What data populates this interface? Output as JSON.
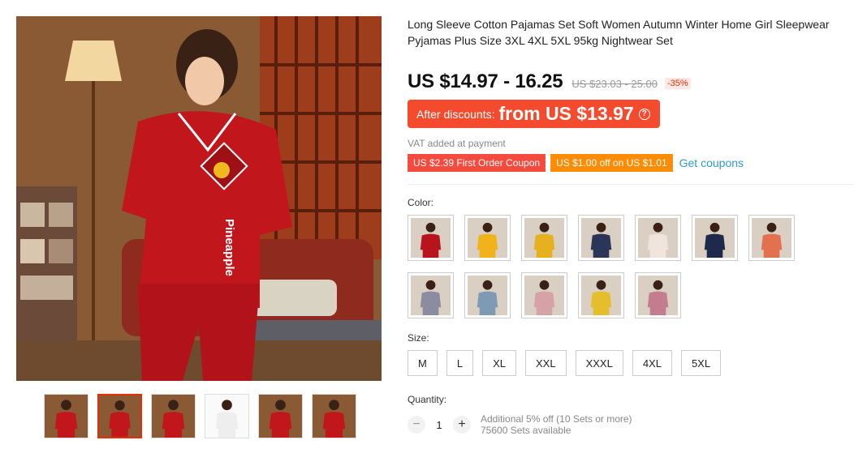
{
  "product": {
    "title": "Long Sleeve Cotton Pajamas Set Soft Women Autumn Winter Home Girl Sleepwear Pyjamas Plus Size 3XL 4XL 5XL 95kg Nightwear Set",
    "main_image_text": "Pineapple",
    "price": "US $14.97 - 16.25",
    "original_price": "US $23.03 - 25.00",
    "discount_badge": "-35%",
    "after_discount_label": "After discounts:",
    "after_discount_amount": "from US $13.97",
    "help_icon_text": "?",
    "vat_note": "VAT added at payment",
    "coupons": [
      "US $2.39 First Order Coupon",
      "US $1.00 off on US $1.01"
    ],
    "get_coupons": "Get coupons",
    "color_label": "Color:",
    "size_label": "Size:",
    "sizes": [
      "M",
      "L",
      "XL",
      "XXL",
      "XXXL",
      "4XL",
      "5XL"
    ],
    "quantity_label": "Quantity:",
    "quantity_value": "1",
    "qty_minus": "−",
    "qty_plus": "+",
    "bulk_note": "Additional 5% off (10 Sets or more)",
    "stock_note": "75600 Sets available"
  },
  "colors": {
    "accent": "#e62e04",
    "after_discount_bg": "#f44b2e",
    "coupon_red": "#f44b3e",
    "coupon_orange": "#fc8c04",
    "link": "#2e9cc3",
    "garment_red": "#c2161d"
  },
  "swatch_colors": [
    "#b8141d",
    "#f1b21c",
    "#e7b01e",
    "#2b3557",
    "#f1e4dc",
    "#1e2a4c",
    "#e3704e",
    "#8b8ca0",
    "#7e9ab5",
    "#d5a2a8",
    "#e5be2c",
    "#c47d8f"
  ],
  "thumbnail_colors": [
    "#c2161d",
    "#c2161d",
    "#c2161d",
    "#eeeeee",
    "#c2161d",
    "#c2161d"
  ],
  "active_thumbnail_index": 1
}
